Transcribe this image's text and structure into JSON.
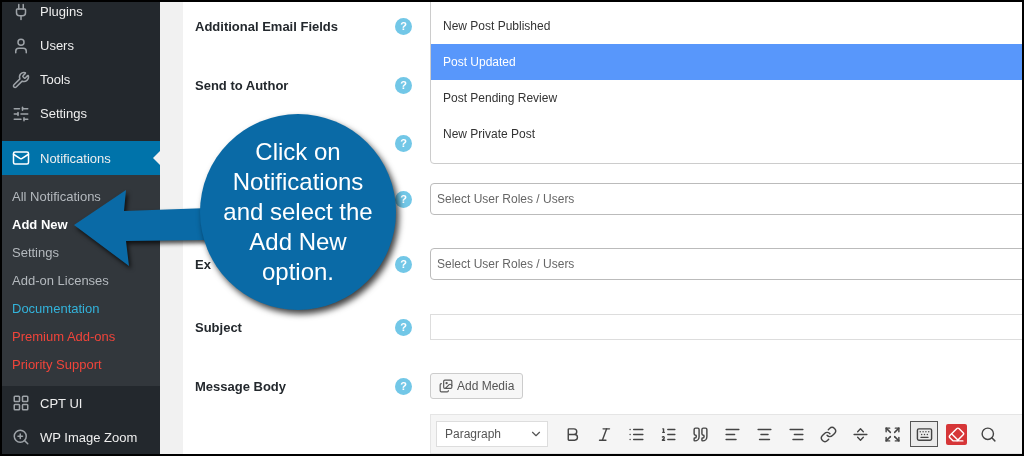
{
  "sidebar": {
    "menu": [
      {
        "label": "Plugins",
        "selected": false
      },
      {
        "label": "Users",
        "selected": false
      },
      {
        "label": "Tools",
        "selected": false
      },
      {
        "label": "Settings",
        "selected": false
      },
      {
        "label": "Notifications",
        "selected": true,
        "children": [
          {
            "label": "All Notifications",
            "selected": false
          },
          {
            "label": "Add New",
            "selected": true
          },
          {
            "label": "Settings",
            "selected": false
          },
          {
            "label": "Add-on Licenses",
            "selected": false
          },
          {
            "label": "Documentation",
            "selected": false,
            "color": "#33b3db"
          },
          {
            "label": "Premium Add-ons",
            "selected": false,
            "color": "#f0443a"
          },
          {
            "label": "Priority Support",
            "selected": false,
            "color": "#f0443a"
          }
        ]
      },
      {
        "label": "CPT UI",
        "selected": false
      },
      {
        "label": "WP Image Zoom",
        "selected": false
      }
    ]
  },
  "form": {
    "rows": [
      {
        "label": "Additional Email Fields",
        "help": "?"
      },
      {
        "label": "Send to Author",
        "help": "?"
      },
      {
        "help": "?"
      },
      {
        "help": "?"
      },
      {
        "label": "Ex",
        "help": "?"
      },
      {
        "label": "Subject",
        "help": "?"
      },
      {
        "label": "Message Body",
        "help": "?"
      }
    ],
    "options": [
      {
        "label": "New Post Published",
        "selected": false
      },
      {
        "label": "Post Updated",
        "selected": true
      },
      {
        "label": "Post Pending Review",
        "selected": false
      },
      {
        "label": "New Private Post",
        "selected": false
      }
    ],
    "selects": [
      {
        "placeholder": "Select User Roles / Users"
      },
      {
        "placeholder": "Select User Roles / Users"
      }
    ],
    "add_media": "Add Media",
    "toolbar": {
      "format": "Paragraph",
      "buttons": [
        {
          "pressed": false
        },
        {
          "pressed": false
        },
        {
          "pressed": false
        },
        {
          "pressed": false
        },
        {
          "pressed": false
        },
        {
          "pressed": false
        },
        {
          "pressed": false
        },
        {
          "pressed": false
        },
        {
          "pressed": false
        },
        {
          "pressed": false
        },
        {
          "pressed": false
        },
        {
          "pressed": true
        },
        {
          "pressed": false
        },
        {
          "pressed": false
        }
      ]
    }
  },
  "callout": {
    "lines": [
      "Click on",
      "Notifications",
      "and select the",
      "Add New",
      "option."
    ]
  }
}
